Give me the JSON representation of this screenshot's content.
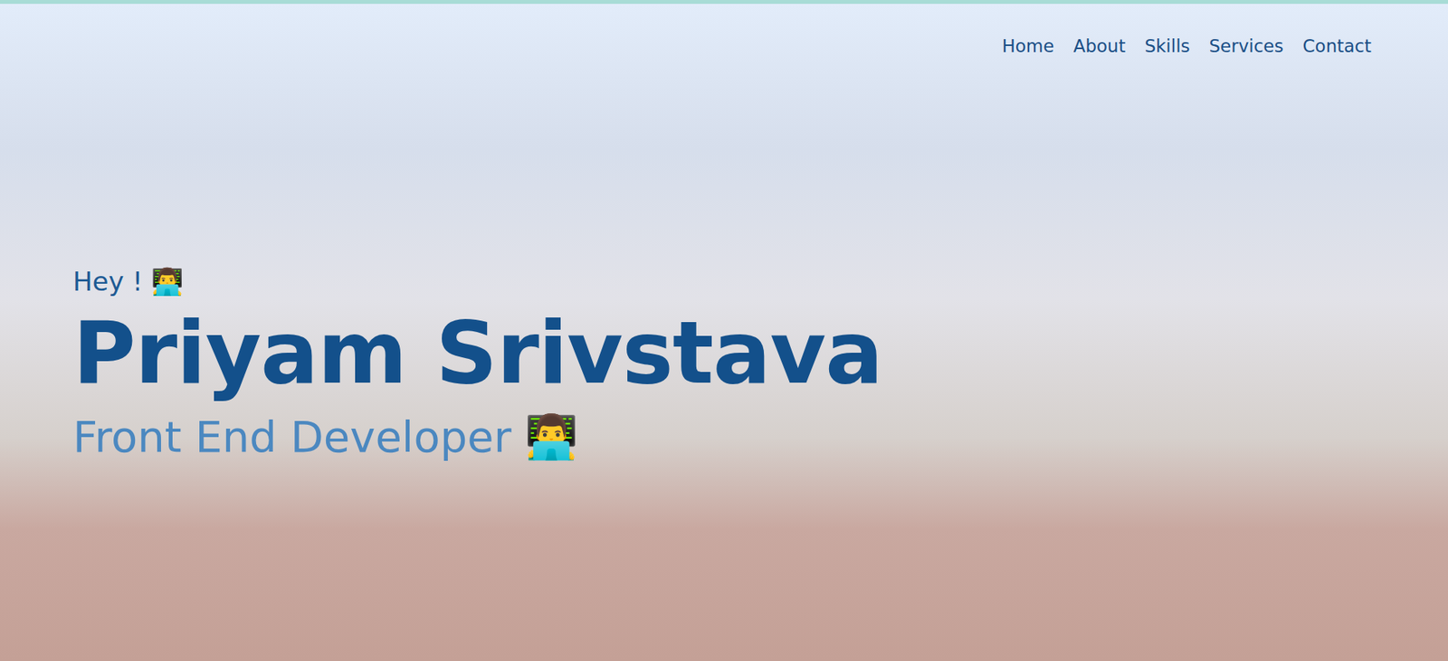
{
  "nav": {
    "items": [
      {
        "label": "Home"
      },
      {
        "label": "About"
      },
      {
        "label": "Skills"
      },
      {
        "label": "Services"
      },
      {
        "label": "Contact"
      }
    ]
  },
  "hero": {
    "greeting": "Hey ! 👨‍💻",
    "name": "Priyam Srivstava",
    "role": "Front End Developer 👨‍💻"
  }
}
